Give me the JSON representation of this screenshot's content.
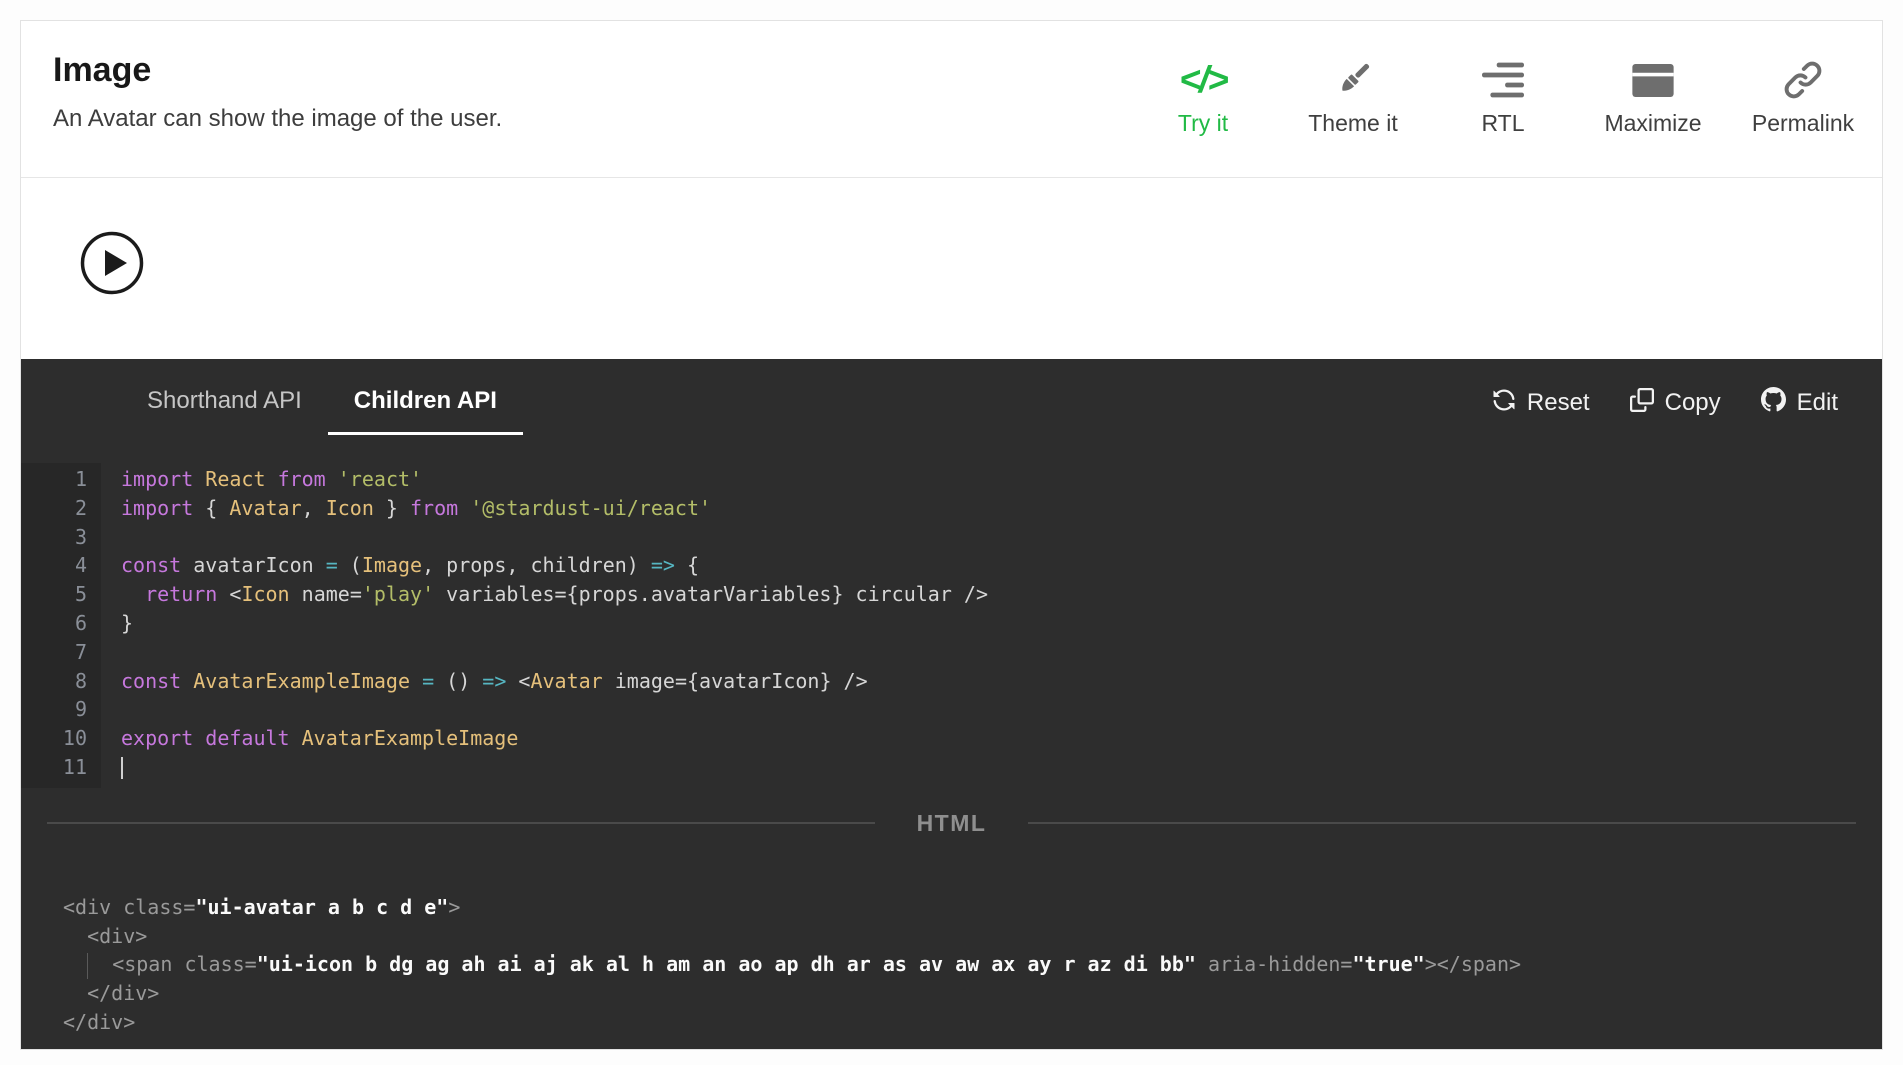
{
  "colors": {
    "accent_green": "#21ba45",
    "editor_background": "#2d2d2d",
    "keyword": "#c678dd",
    "component": "#e5c07b",
    "string": "#b3bd68",
    "operator": "#56b6c2"
  },
  "header": {
    "title": "Image",
    "subtitle": "An Avatar can show the image of the user.",
    "actions": [
      {
        "label": "Try it",
        "icon": "code-icon"
      },
      {
        "label": "Theme it",
        "icon": "paintbrush-icon"
      },
      {
        "label": "RTL",
        "icon": "rtl-align-icon"
      },
      {
        "label": "Maximize",
        "icon": "window-icon"
      },
      {
        "label": "Permalink",
        "icon": "link-icon"
      }
    ]
  },
  "preview": {
    "icon": "play-circle-icon"
  },
  "editor": {
    "tabs": [
      {
        "label": "Shorthand API",
        "active": false
      },
      {
        "label": "Children API",
        "active": true
      }
    ],
    "actions": [
      {
        "label": "Reset",
        "icon": "refresh-icon"
      },
      {
        "label": "Copy",
        "icon": "copy-icon"
      },
      {
        "label": "Edit",
        "icon": "github-icon"
      }
    ],
    "code_lines": [
      {
        "num": "1",
        "tokens": [
          [
            "k",
            "import"
          ],
          [
            "p",
            " "
          ],
          [
            "t",
            "React"
          ],
          [
            "p",
            " "
          ],
          [
            "k",
            "from"
          ],
          [
            "p",
            " "
          ],
          [
            "s",
            "'react'"
          ]
        ]
      },
      {
        "num": "2",
        "tokens": [
          [
            "k",
            "import"
          ],
          [
            "p",
            " { "
          ],
          [
            "t",
            "Avatar"
          ],
          [
            "p",
            ", "
          ],
          [
            "t",
            "Icon"
          ],
          [
            "p",
            " } "
          ],
          [
            "k",
            "from"
          ],
          [
            "p",
            " "
          ],
          [
            "s",
            "'@stardust-ui/react'"
          ]
        ]
      },
      {
        "num": "3",
        "tokens": []
      },
      {
        "num": "4",
        "tokens": [
          [
            "k",
            "const"
          ],
          [
            "p",
            " avatarIcon "
          ],
          [
            "o",
            "="
          ],
          [
            "p",
            " ("
          ],
          [
            "t",
            "Image"
          ],
          [
            "p",
            ", props, children) "
          ],
          [
            "o",
            "=>"
          ],
          [
            "p",
            " {"
          ]
        ]
      },
      {
        "num": "5",
        "tokens": [
          [
            "p",
            "  "
          ],
          [
            "k",
            "return"
          ],
          [
            "p",
            " <"
          ],
          [
            "t",
            "Icon"
          ],
          [
            "p",
            " name="
          ],
          [
            "s",
            "'play'"
          ],
          [
            "p",
            " variables={props.avatarVariables} circular />"
          ]
        ]
      },
      {
        "num": "6",
        "tokens": [
          [
            "p",
            "}"
          ]
        ]
      },
      {
        "num": "7",
        "tokens": []
      },
      {
        "num": "8",
        "tokens": [
          [
            "k",
            "const"
          ],
          [
            "p",
            " "
          ],
          [
            "t",
            "AvatarExampleImage"
          ],
          [
            "p",
            " "
          ],
          [
            "o",
            "="
          ],
          [
            "p",
            " () "
          ],
          [
            "o",
            "=>"
          ],
          [
            "p",
            " <"
          ],
          [
            "t",
            "Avatar"
          ],
          [
            "p",
            " image={avatarIcon} />"
          ]
        ]
      },
      {
        "num": "9",
        "tokens": []
      },
      {
        "num": "10",
        "tokens": [
          [
            "k",
            "export"
          ],
          [
            "p",
            " "
          ],
          [
            "k",
            "default"
          ],
          [
            "p",
            " "
          ],
          [
            "t",
            "AvatarExampleImage"
          ]
        ]
      },
      {
        "num": "11",
        "tokens": [
          [
            "cursor",
            ""
          ]
        ]
      }
    ],
    "html_divider": "HTML",
    "html_lines": [
      {
        "tokens": [
          [
            "g",
            "<div"
          ],
          [
            "p",
            " "
          ],
          [
            "g",
            "class="
          ],
          [
            "w",
            "\"ui-avatar a b c d e\""
          ],
          [
            "g",
            ">"
          ]
        ]
      },
      {
        "tokens": [
          [
            "g",
            "  <div>"
          ]
        ]
      },
      {
        "tokens": [
          [
            "g",
            "  "
          ],
          [
            "guide",
            ""
          ],
          [
            "g",
            "  "
          ],
          [
            "g",
            "<span"
          ],
          [
            "p",
            " "
          ],
          [
            "g",
            "class="
          ],
          [
            "w",
            "\"ui-icon b dg ag ah ai aj ak al h am an ao ap dh ar as av aw ax ay r az di bb\""
          ],
          [
            "p",
            " "
          ],
          [
            "g",
            "aria-hidden="
          ],
          [
            "w",
            "\"true\""
          ],
          [
            "g",
            "></span>"
          ]
        ]
      },
      {
        "tokens": [
          [
            "g",
            "  </div>"
          ]
        ]
      },
      {
        "tokens": [
          [
            "g",
            "</div>"
          ]
        ]
      }
    ]
  }
}
